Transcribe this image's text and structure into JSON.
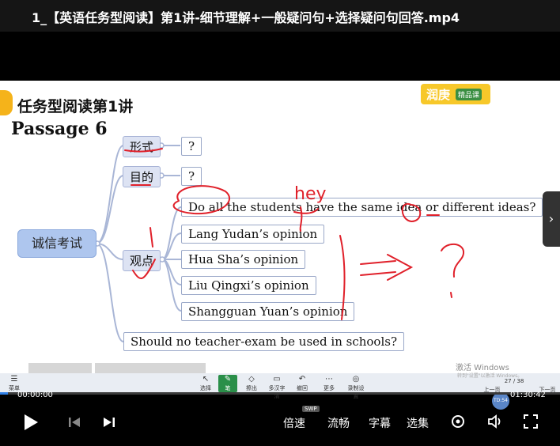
{
  "window": {
    "title": "1_【英语任务型阅读】第1讲-细节理解+一般疑问句+选择疑问句回答.mp4"
  },
  "slide": {
    "heading": "任务型阅读第1讲",
    "brand_main": "润庚",
    "brand_sub": "精品课",
    "passage": "Passage 6",
    "root": "诚信考试",
    "categories": [
      "形式",
      "目的",
      "观点"
    ],
    "form_answer": "?",
    "purpose_answer": "?",
    "question": "Do all the students have the same idea or different ideas?",
    "opinions": [
      "Lang Yudan’s opinion",
      "Hua Sha’s opinion",
      "Liu Qingxi’s opinion",
      "Shangguan Yuan’s opinion"
    ],
    "bottom_question": "Should no teacher-exam be used in schools?",
    "annotation_text": "hey",
    "annotation_mark": "?"
  },
  "app_toolbar": {
    "items": [
      "菜单",
      "选择",
      "笔",
      "擦出",
      "多汉字清",
      "撤回",
      "更多",
      "录制设置"
    ],
    "page": "27 / 38",
    "prev": "上一页",
    "next": "下一页",
    "timer": "TD:54"
  },
  "watermark": {
    "line1": "激活 Windows",
    "line2": "转到\"设置\"以激活 Windows。"
  },
  "player": {
    "current_time": "00:00:00",
    "duration": "01:30:42",
    "progress": 0.014,
    "speed_label": "倍速",
    "swp_badge": "SWP",
    "quality_label": "流畅",
    "subtitle_label": "字幕",
    "episodes_label": "选集"
  },
  "colors": {
    "accent": "#2f7fe6",
    "ink_red": "#e0202a",
    "brand_yellow": "#f7c82a",
    "toolbar_green": "#2a8f49"
  }
}
